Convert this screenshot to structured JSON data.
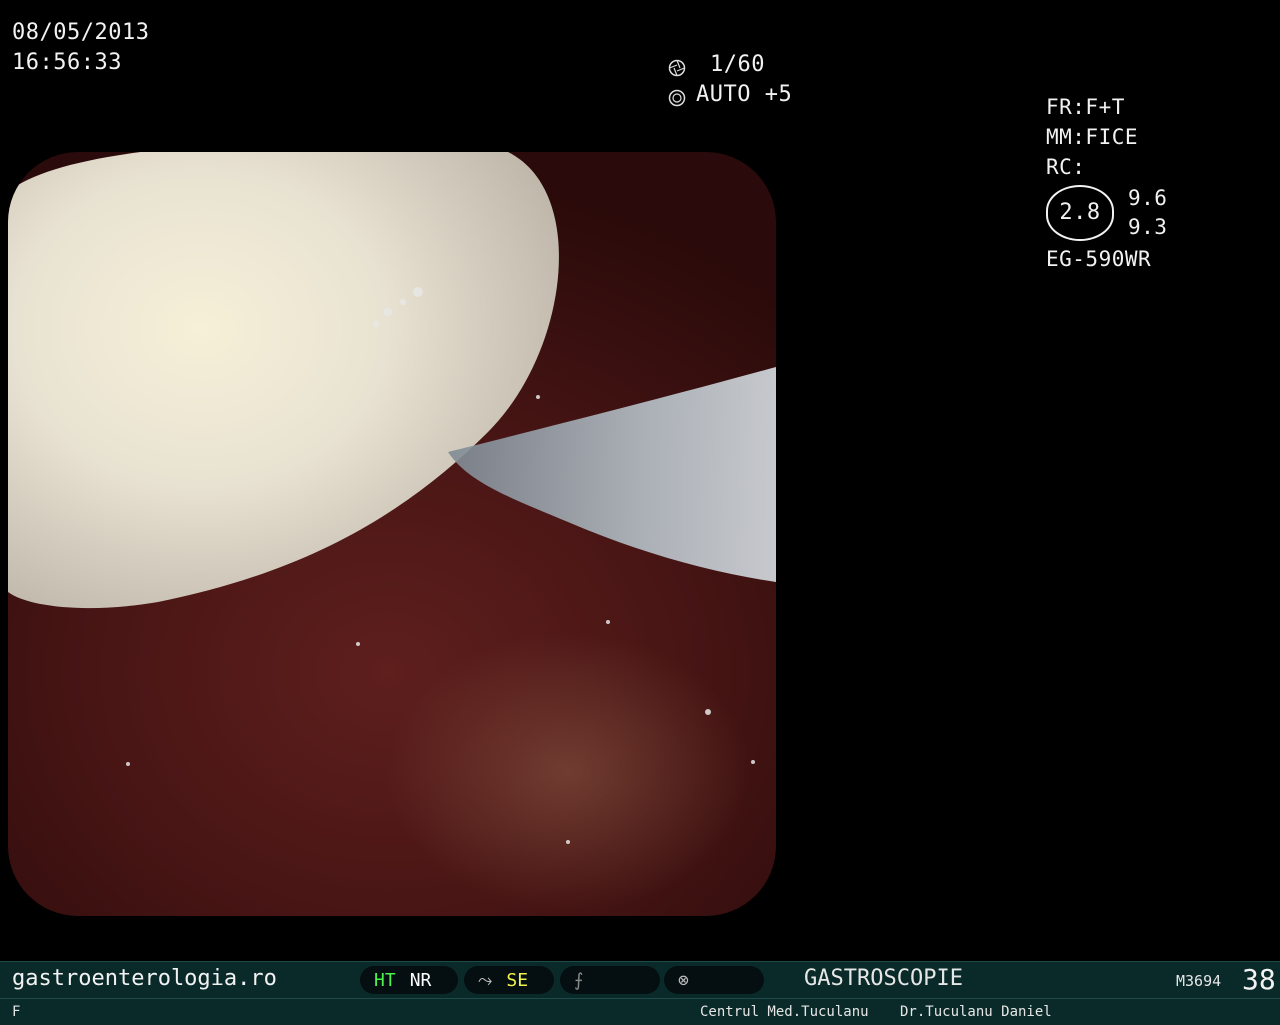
{
  "overlay": {
    "date": "08/05/2013",
    "time": "16:56:33",
    "shutter": "1/60",
    "iris": "AUTO +5",
    "fr": "FR:F+T",
    "mm": "MM:FICE",
    "rc": "RC:",
    "rc_center": "2.8",
    "rc_val_top": "9.6",
    "rc_val_bottom": "9.3",
    "scope_model": "EG-590WR"
  },
  "bottom_bar": {
    "website": "gastroenterologia.ro",
    "ht": "HT",
    "nr": "NR",
    "se": "SE",
    "procedure": "GASTROSCOPIE",
    "code": "M3694",
    "number": "38"
  },
  "status_bar": {
    "left": "F",
    "clinic": "Centrul Med.Tuculanu",
    "doctor": "Dr.Tuculanu Daniel"
  },
  "colors": {
    "green_indicator": "#4df24d",
    "yellow_indicator": "#f2f24d",
    "bar_background": "#0a2a2a"
  }
}
